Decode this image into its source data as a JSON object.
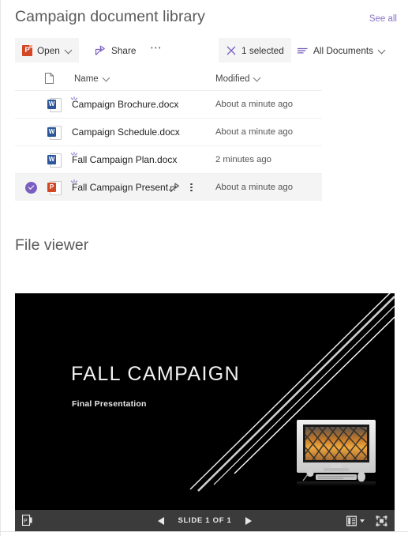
{
  "library": {
    "title": "Campaign document library",
    "see_all_label": "See all",
    "commands": [
      {
        "name": "open",
        "label": "Open",
        "icon": "powerpoint-icon",
        "has_chevron": true,
        "selected": true
      },
      {
        "name": "share",
        "label": "Share",
        "icon": "share-icon",
        "has_chevron": false,
        "selected": false
      },
      {
        "name": "more",
        "label": "...",
        "icon": "ellipsis-icon",
        "has_chevron": false,
        "selected": false
      },
      {
        "name": "selection-count",
        "label": "1 selected",
        "icon": "close-x-icon",
        "has_chevron": false,
        "selected": true
      },
      {
        "name": "view-filter",
        "label": "All Documents",
        "icon": "filter-lines-icon",
        "has_chevron": true,
        "selected": false
      }
    ],
    "columns": {
      "doc_icon": "document-icon",
      "name": "Name",
      "modified": "Modified"
    },
    "rows": [
      {
        "name": "Campaign Brochure.docx",
        "modified": "About a minute ago",
        "type": "word",
        "selected": false,
        "is_new": true
      },
      {
        "name": "Campaign Schedule.docx",
        "modified": "About a minute ago",
        "type": "word",
        "selected": false,
        "is_new": false
      },
      {
        "name": "Fall Campaign Plan.docx",
        "modified": "2 minutes ago",
        "type": "word",
        "selected": false,
        "is_new": true
      },
      {
        "name": "Fall Campaign Present...",
        "modified": "About a minute ago",
        "type": "ppt",
        "selected": true,
        "is_new": true
      }
    ]
  },
  "file_viewer": {
    "title": "File viewer",
    "slide": {
      "title": "FALL CAMPAIGN",
      "subtitle": "Final Presentation",
      "background_color": "#000000",
      "text_color": "#f2f2f2",
      "graphic": "desktop-computer-sunset-image"
    },
    "toolbar": {
      "app_icon": "powerpoint-icon",
      "prev_label": "Previous slide",
      "next_label": "Next slide",
      "slide_count": "SLIDE 1 OF 1",
      "view_label": "View options",
      "fullscreen_label": "Full screen",
      "background_color": "#3b3b3b"
    }
  },
  "colors": {
    "accent_purple": "#7b5fc0",
    "link_purple": "#8a74c8",
    "word_blue": "#2b579a",
    "ppt_orange": "#d24726",
    "selected_row": "#f4f4f4"
  }
}
